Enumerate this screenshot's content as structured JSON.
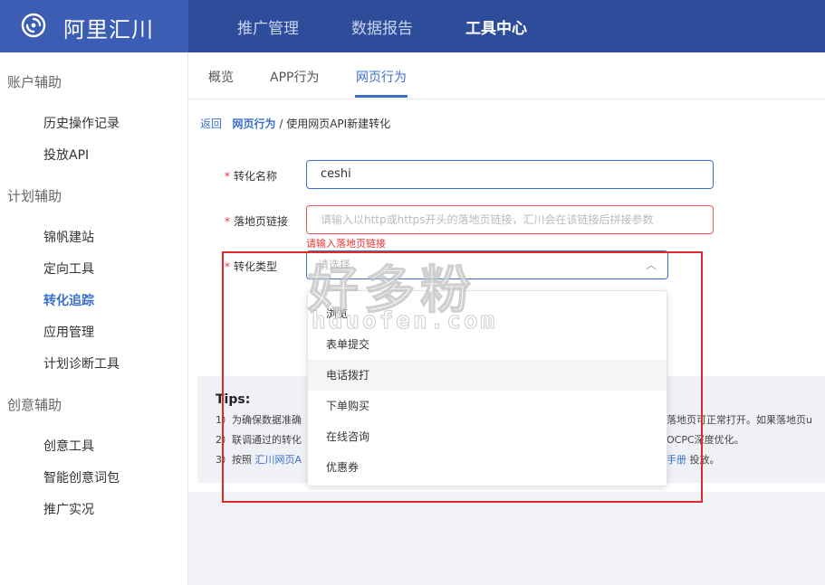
{
  "brand": {
    "name": "阿里汇川"
  },
  "topnav": {
    "items": [
      "推广管理",
      "数据报告",
      "工具中心"
    ],
    "active_index": 2
  },
  "sidebar": {
    "groups": [
      {
        "title": "账户辅助",
        "items": [
          "历史操作记录",
          "投放API"
        ]
      },
      {
        "title": "计划辅助",
        "items": [
          "锦帆建站",
          "定向工具",
          "转化追踪",
          "应用管理",
          "计划诊断工具"
        ]
      },
      {
        "title": "创意辅助",
        "items": [
          "创意工具",
          "智能创意词包",
          "推广实况"
        ]
      }
    ],
    "active_item": "转化追踪"
  },
  "tabs": {
    "items": [
      "概览",
      "APP行为",
      "网页行为"
    ],
    "active_index": 2
  },
  "breadcrumb": {
    "back": "返回",
    "parent": "网页行为",
    "separator": "/",
    "current": "使用网页API新建转化"
  },
  "form": {
    "name_label": "转化名称",
    "name_value": "ceshi",
    "landing_label": "落地页链接",
    "landing_placeholder": "请输入以http或https开头的落地页链接，汇川会在该链接后拼接参数",
    "landing_error": "请输入落地页链接",
    "type_label": "转化类型",
    "type_placeholder": "请选择",
    "required_mark": "*"
  },
  "dropdown": {
    "options": [
      "浏览",
      "表单提交",
      "电话拨打",
      "下单购买",
      "在线咨询",
      "优惠券"
    ],
    "hover_index": 2
  },
  "tips": {
    "title": "Tips:",
    "line1_start": "1）为确保数据准确",
    "line1_end": "落地页可正常打开。如果落地页u",
    "line2_start": "2）联调通过的转化",
    "line2_end": "OCPC深度优化。",
    "line3_start": "3）按照",
    "line3_link": "汇川网页A",
    "line3_end_link": "手册",
    "line3_end": "投放。"
  },
  "watermark": {
    "text": "好多粉",
    "sub": "hduofen.com"
  },
  "colors": {
    "brand": "#3b5db3",
    "topbar": "#2d4c9a",
    "accent": "#3b6fcf",
    "error": "#e33",
    "highlight": "#e02a2a"
  }
}
